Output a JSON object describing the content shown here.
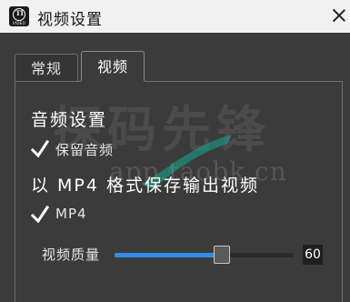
{
  "window": {
    "title": "视频设置",
    "icon": "app-logo-icon",
    "logo_text": "TI",
    "logo_sub": "VIDEO"
  },
  "tabs": [
    {
      "label": "常规",
      "active": false
    },
    {
      "label": "视频",
      "active": true
    }
  ],
  "audio_section": {
    "title": "音频设置",
    "keep_audio": {
      "label": "保留音频",
      "checked": true
    }
  },
  "mp4_section": {
    "title": "以 MP4 格式保存输出视频",
    "mp4": {
      "label": "MP4",
      "checked": true
    }
  },
  "quality": {
    "label": "视频质量",
    "value": "60",
    "fraction": 0.6
  },
  "watermark": {
    "main": "探码先锋",
    "sub": "app.taobk.cn"
  },
  "colors": {
    "accent": "#2f8fe8",
    "background": "#3b3b3b",
    "titlebar": "#f1f1f1"
  }
}
